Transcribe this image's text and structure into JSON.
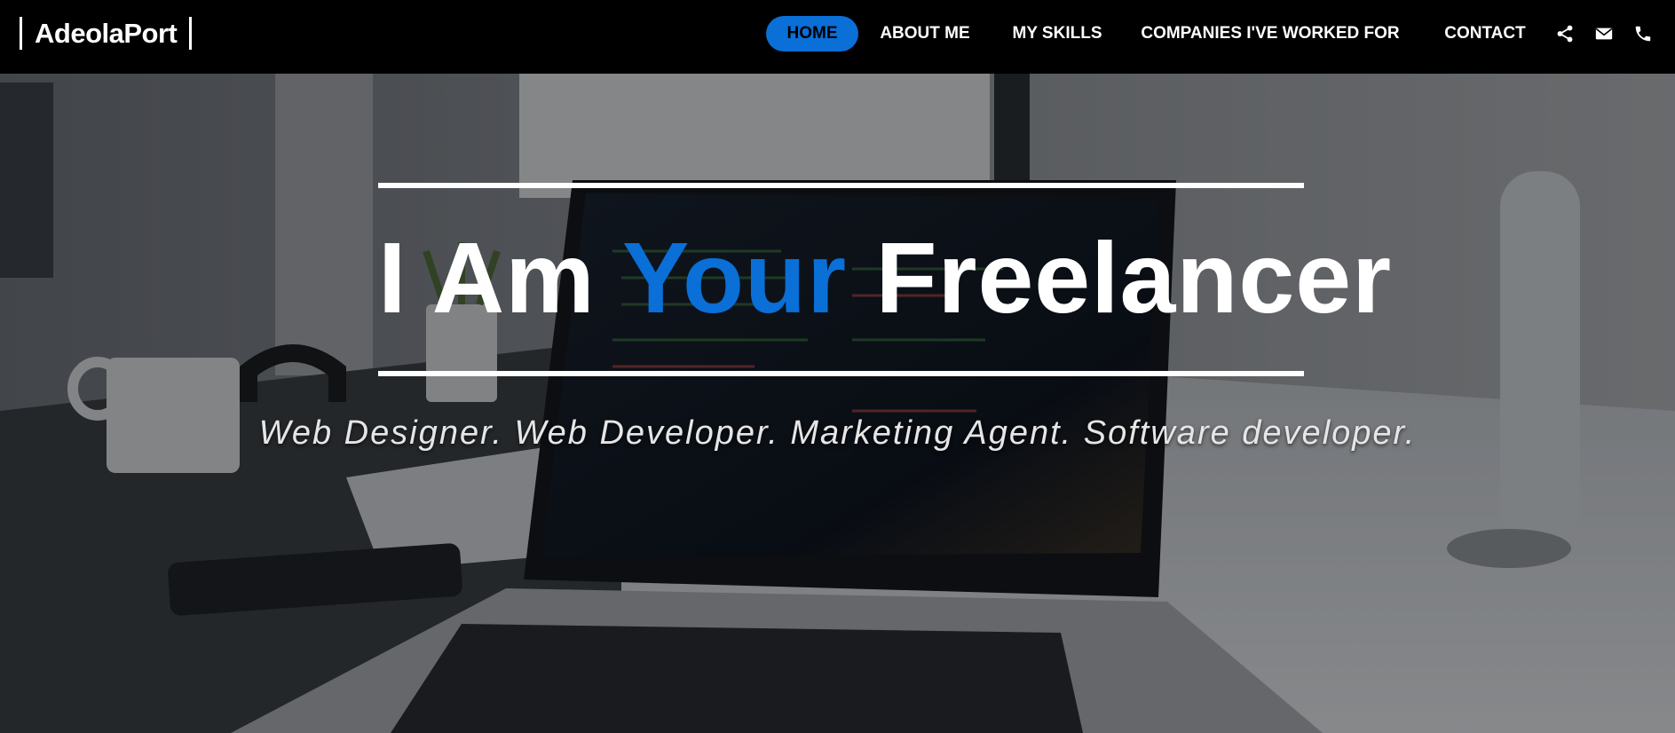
{
  "brand": {
    "name": "AdeolaPort"
  },
  "nav": {
    "items": [
      {
        "label": "HOME",
        "active": true
      },
      {
        "label": "ABOUT ME",
        "active": false
      },
      {
        "label": "MY SKILLS",
        "active": false
      },
      {
        "label": "COMPANIES I'VE WORKED FOR",
        "active": false
      },
      {
        "label": "CONTACT",
        "active": false
      }
    ],
    "icons": [
      "share-icon",
      "envelope-icon",
      "phone-icon"
    ]
  },
  "hero": {
    "headline": {
      "part1": "I Am ",
      "accent": "Your",
      "part2": " Freelancer"
    },
    "tagline": "Web Designer. Web Developer. Marketing Agent. Software developer."
  },
  "colors": {
    "navbar_bg": "#000000",
    "accent": "#0a6fd6",
    "text": "#ffffff"
  }
}
